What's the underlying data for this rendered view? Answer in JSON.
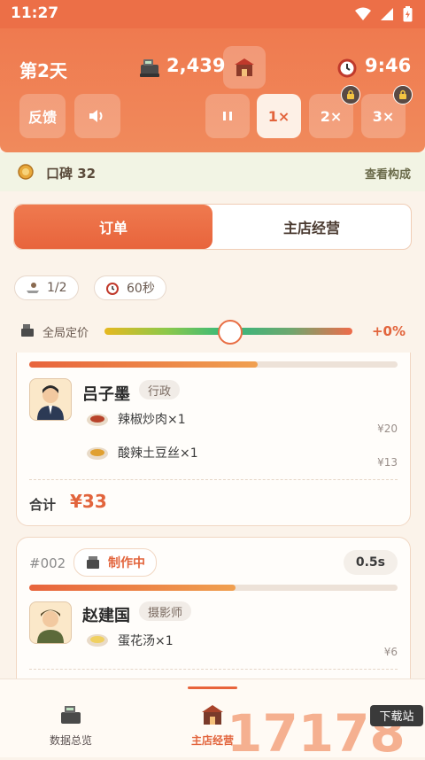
{
  "status_bar": {
    "time": "11:27"
  },
  "header": {
    "day": "第2天",
    "money": "2,439",
    "clock": "9:46",
    "feedback_label": "反馈",
    "speeds": [
      "1×",
      "2×",
      "3×"
    ]
  },
  "reputation": {
    "label": "口碑 32",
    "link": "查看构成"
  },
  "tabs": [
    "订单",
    "主店经营"
  ],
  "chips": {
    "seats": "1/2",
    "time": "60秒"
  },
  "pricing": {
    "label": "全局定价",
    "value": "+0%",
    "level": 0.5
  },
  "orders": [
    {
      "progress": 0.62,
      "customer": "吕子墨",
      "role": "行政",
      "items": [
        {
          "name": "辣椒炒肉×1",
          "price": "¥20"
        },
        {
          "name": "酸辣土豆丝×1",
          "price": "¥13"
        }
      ],
      "total_label": "合计",
      "total": "¥33"
    },
    {
      "number": "#002",
      "status": "制作中",
      "timer": "0.5s",
      "progress": 0.56,
      "customer": "赵建国",
      "role": "摄影师",
      "items": [
        {
          "name": "蛋花汤×1",
          "price": "¥6"
        }
      ]
    }
  ],
  "bottom_nav": [
    "数据总览",
    "主店经营"
  ],
  "watermark": {
    "digits": "17178",
    "badge": "下载站"
  },
  "colors": {
    "accent": "#e8643c",
    "header": "#ef7a4f",
    "background": "#fbf3ea"
  }
}
